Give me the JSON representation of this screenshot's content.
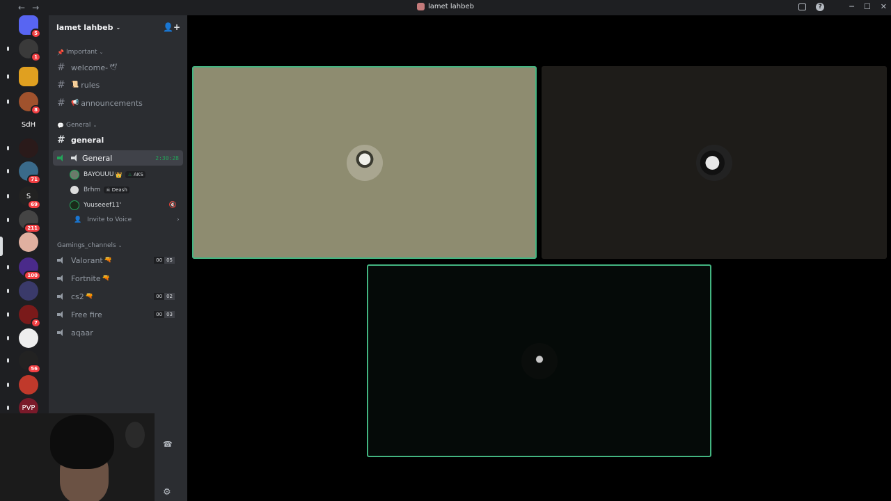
{
  "window": {
    "title": "lamet lahbeb"
  },
  "server": {
    "name": "lamet lahbeb"
  },
  "servers": [
    {
      "label": "",
      "badge": "5",
      "color": "#5865f2"
    },
    {
      "label": "",
      "badge": "1",
      "color": "#3a3a3a"
    },
    {
      "label": "",
      "badge": "",
      "color": "#e0a020"
    },
    {
      "label": "",
      "badge": "8",
      "color": "#a0522d"
    },
    {
      "label": "SdH",
      "badge": "",
      "color": "#1e1f22"
    },
    {
      "label": "",
      "badge": "",
      "color": "#2a1a1a"
    },
    {
      "label": "",
      "badge": "71",
      "color": "#3a6a8a"
    },
    {
      "label": "S",
      "badge": "69",
      "color": "#222"
    },
    {
      "label": "",
      "badge": "211",
      "color": "#444"
    },
    {
      "label": "",
      "badge": "",
      "color": "#e0b0a0"
    },
    {
      "label": "",
      "badge": "100",
      "color": "#4a2a8a"
    },
    {
      "label": "",
      "badge": "",
      "color": "#3a3a6a"
    },
    {
      "label": "",
      "badge": "7",
      "color": "#7a1a1a"
    },
    {
      "label": "",
      "badge": "",
      "color": "#eee"
    },
    {
      "label": "",
      "badge": "56",
      "color": "#222"
    },
    {
      "label": "",
      "badge": "",
      "color": "#c0392b"
    },
    {
      "label": "PVP",
      "badge": "",
      "color": "#7a1a2a"
    }
  ],
  "categories": {
    "important": "Important",
    "general": "General",
    "gaming": "Gamings_channels"
  },
  "channels": {
    "welcome": {
      "label": "welcome-",
      "emoji": "🕊"
    },
    "rules": {
      "label": "rules",
      "emoji": "📜"
    },
    "announcements": {
      "label": "announcements",
      "emoji": "📢"
    },
    "general_text": {
      "label": "general"
    },
    "general_voice": {
      "label": "General",
      "timer": "2:30:28"
    },
    "valorant": {
      "label": "Valorant",
      "emoji": "🔫",
      "count_a": "00",
      "count_b": "05"
    },
    "fortnite": {
      "label": "Fortnite",
      "emoji": "🔫"
    },
    "cs2": {
      "label": "cs2",
      "emoji": "🔫",
      "count_a": "00",
      "count_b": "02"
    },
    "freefire": {
      "label": "Free fire",
      "count_a": "00",
      "count_b": "03"
    },
    "aqaar": {
      "label": "aqaar"
    }
  },
  "voice_users": [
    {
      "name": "BAYOUUU",
      "crown": "👑",
      "tag": "AKS"
    },
    {
      "name": "Brhm",
      "tag": "Deash"
    },
    {
      "name": "Yuuseeef11'",
      "muted": true
    }
  ],
  "invite_to_voice": "Invite to Voice",
  "colors": {
    "speaking_border": "#43b581",
    "tile_1_bg": "#8e8c70",
    "tile_2_bg": "#1e1c19",
    "tile_3_bg": "#050a08",
    "rail_bg": "#1e1f22",
    "sidebar_bg": "#2b2d31"
  }
}
